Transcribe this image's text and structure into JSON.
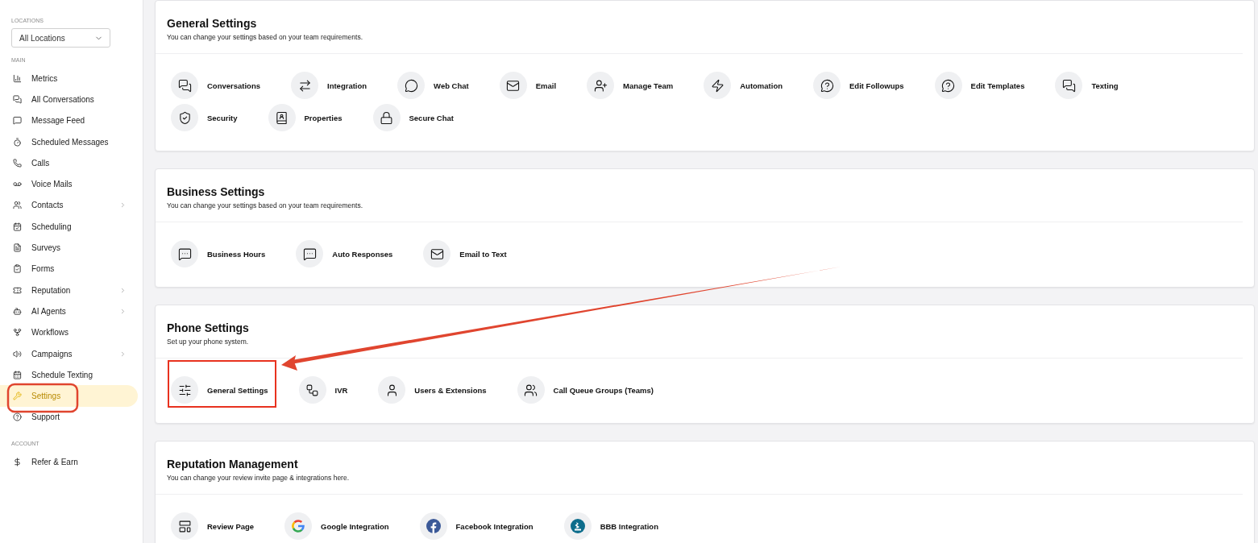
{
  "sidebar": {
    "locations_label": "LOCATIONS",
    "location_select": "All Locations",
    "sections": [
      {
        "label": "MAIN",
        "items": [
          {
            "label": "Metrics",
            "selected": false,
            "submenu": false
          },
          {
            "label": "All Conversations",
            "selected": false,
            "submenu": false
          },
          {
            "label": "Message Feed",
            "selected": false,
            "submenu": false
          },
          {
            "label": "Scheduled Messages",
            "selected": false,
            "submenu": false
          },
          {
            "label": "Calls",
            "selected": false,
            "submenu": false
          },
          {
            "label": "Voice Mails",
            "selected": false,
            "submenu": false
          },
          {
            "label": "Contacts",
            "selected": false,
            "submenu": true
          },
          {
            "label": "Scheduling",
            "selected": false,
            "submenu": false
          },
          {
            "label": "Surveys",
            "selected": false,
            "submenu": false
          },
          {
            "label": "Forms",
            "selected": false,
            "submenu": false
          },
          {
            "label": "Reputation",
            "selected": false,
            "submenu": true
          },
          {
            "label": "AI Agents",
            "selected": false,
            "submenu": true
          },
          {
            "label": "Workflows",
            "selected": false,
            "submenu": false
          },
          {
            "label": "Campaigns",
            "selected": false,
            "submenu": true
          },
          {
            "label": "Schedule Texting",
            "selected": false,
            "submenu": false
          },
          {
            "label": "Settings",
            "selected": true,
            "submenu": false
          },
          {
            "label": "Support",
            "selected": false,
            "submenu": false
          }
        ]
      },
      {
        "label": "ACCOUNT",
        "items": [
          {
            "label": "Refer & Earn",
            "selected": false,
            "submenu": false
          }
        ]
      }
    ]
  },
  "cards": [
    {
      "title": "General Settings",
      "subtitle": "You can change your settings based on your team requirements.",
      "items": [
        "Conversations",
        "Integration",
        "Web Chat",
        "Email",
        "Manage Team",
        "Automation",
        "Edit Followups",
        "Edit Templates",
        "Texting",
        "Security",
        "Properties",
        "Secure Chat"
      ]
    },
    {
      "title": "Business Settings",
      "subtitle": "You can change your settings based on your team requirements.",
      "items": [
        "Business Hours",
        "Auto Responses",
        "Email to Text"
      ]
    },
    {
      "title": "Phone Settings",
      "subtitle": "Set up your phone system.",
      "items": [
        "General Settings",
        "IVR",
        "Users & Extensions",
        "Call Queue Groups (Teams)"
      ]
    },
    {
      "title": "Reputation Management",
      "subtitle": "You can change your review invite page & integrations here.",
      "items": [
        "Review Page",
        "Google Integration",
        "Facebook Integration",
        "BBB Integration"
      ]
    }
  ]
}
